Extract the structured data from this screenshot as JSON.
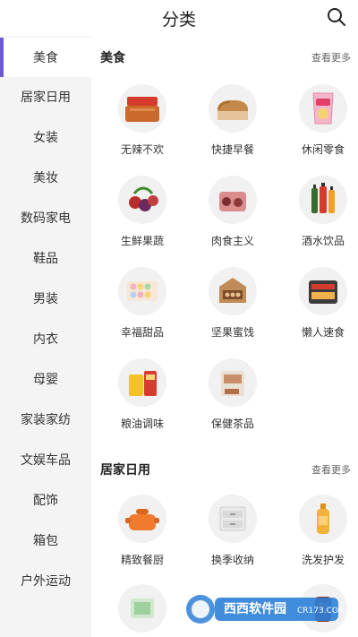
{
  "header": {
    "title": "分类",
    "search_icon": "search-icon"
  },
  "sidebar": {
    "items": [
      {
        "label": "美食"
      },
      {
        "label": "居家日用"
      },
      {
        "label": "女装"
      },
      {
        "label": "美妆"
      },
      {
        "label": "数码家电"
      },
      {
        "label": "鞋品"
      },
      {
        "label": "男装"
      },
      {
        "label": "内衣"
      },
      {
        "label": "母婴"
      },
      {
        "label": "家装家纺"
      },
      {
        "label": "文娱车品"
      },
      {
        "label": "配饰"
      },
      {
        "label": "箱包"
      },
      {
        "label": "户外运动"
      }
    ],
    "active_color": "#6b5ad1"
  },
  "sections": [
    {
      "title": "美食",
      "more": "查看更多",
      "items": [
        {
          "label": "无辣不欢",
          "icon": "spicy-snack-icon"
        },
        {
          "label": "快捷早餐",
          "icon": "bread-icon"
        },
        {
          "label": "休闲零食",
          "icon": "chips-bag-icon"
        },
        {
          "label": "生鲜果蔬",
          "icon": "fruits-icon"
        },
        {
          "label": "肉食主义",
          "icon": "meat-icon"
        },
        {
          "label": "酒水饮品",
          "icon": "drinks-icon"
        },
        {
          "label": "幸福甜品",
          "icon": "macaron-icon"
        },
        {
          "label": "坚果蜜饯",
          "icon": "nuts-gift-box-icon"
        },
        {
          "label": "懒人速食",
          "icon": "instant-noodles-icon"
        },
        {
          "label": "粮油调味",
          "icon": "oil-rice-icon"
        },
        {
          "label": "保健茶品",
          "icon": "tea-icon"
        }
      ]
    },
    {
      "title": "居家日用",
      "more": "查看更多",
      "items": [
        {
          "label": "精致餐厨",
          "icon": "pot-icon"
        },
        {
          "label": "换季收纳",
          "icon": "storage-drawer-icon"
        },
        {
          "label": "洗发护发",
          "icon": "shampoo-bottle-icon"
        }
      ]
    }
  ],
  "watermark": {
    "text": "西西软件园",
    "sub": "CR173.COM"
  }
}
